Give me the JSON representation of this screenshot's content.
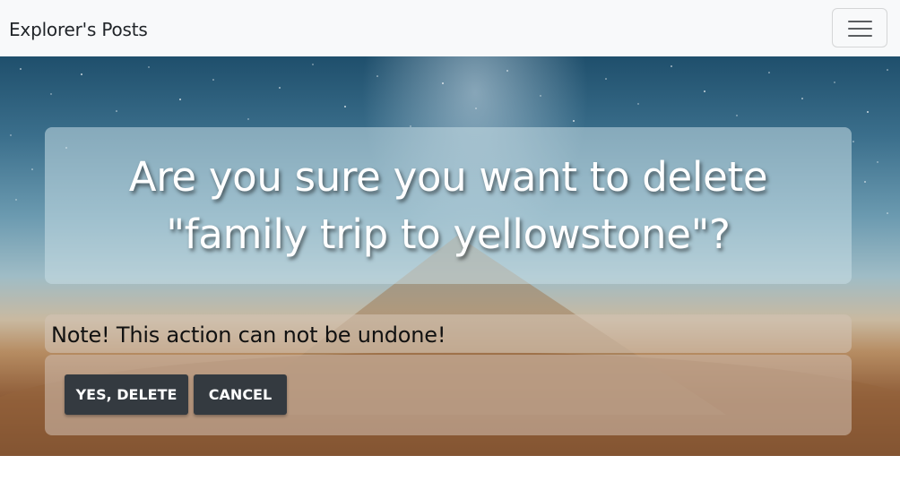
{
  "navbar": {
    "brand": "Explorer's Posts",
    "toggler_icon": "hamburger-menu-icon"
  },
  "dialog": {
    "title": "Are you sure you want to delete \"family trip to yellowstone\"?",
    "note": "Note! This action can not be undone!",
    "confirm_label": "YES, DELETE",
    "cancel_label": "CANCEL"
  },
  "colors": {
    "navbar_bg": "#f8f9fa",
    "button_bg": "#343a40",
    "button_text": "#ffffff"
  }
}
